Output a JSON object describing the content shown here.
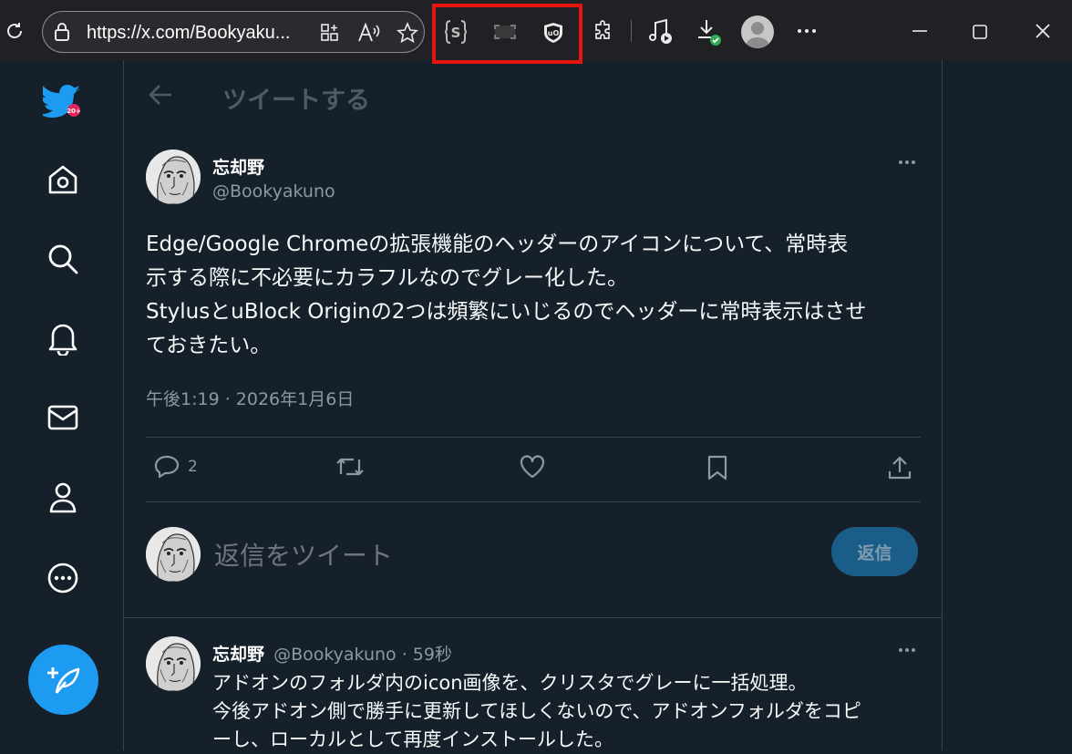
{
  "browser": {
    "url": "https://x.com/Bookyaku...",
    "icons": [
      "refresh-icon",
      "lock-icon",
      "add-tab-icon",
      "read-aloud-icon",
      "favorite-star-icon",
      "stylus-extension-icon",
      "screenshot-extension-icon",
      "ublock-origin-extension-icon",
      "extensions-puzzle-icon",
      "media-control-icon",
      "downloads-icon",
      "profile-avatar",
      "more-menu-icon",
      "minimize-icon",
      "maximize-icon",
      "close-icon"
    ],
    "highlight_color": "#e3150d"
  },
  "header": {
    "title": "ツイートする"
  },
  "tweet": {
    "name": "忘却野",
    "handle": "@Bookyakuno",
    "lines": [
      "Edge/Google Chromeの拡張機能のヘッダーのアイコンについて、常時表",
      "示する際に不必要にカラフルなのでグレー化した。",
      "StylusとuBlock Originの2つは頻繁にいじるのでヘッダーに常時表示はさせ",
      "ておきたい。"
    ],
    "timestamp": "午後1:19 · 2026年1月6日",
    "reply_count": "2"
  },
  "compose": {
    "placeholder": "返信をツイート",
    "button": "返信"
  },
  "reply": {
    "name": "忘却野",
    "meta": "@Bookyakuno · 59秒",
    "lines": [
      "アドオンのフォルダ内のicon画像を、クリスタでグレーに一括処理。",
      "今後アドオン側で勝手に更新してほしくないので、アドオンフォルダをコピ",
      "ーし、ローカルとして再度インストールした。"
    ]
  },
  "colors": {
    "accent": "#1d9bf0",
    "background": "#15202b",
    "toolbar": "#202124"
  }
}
